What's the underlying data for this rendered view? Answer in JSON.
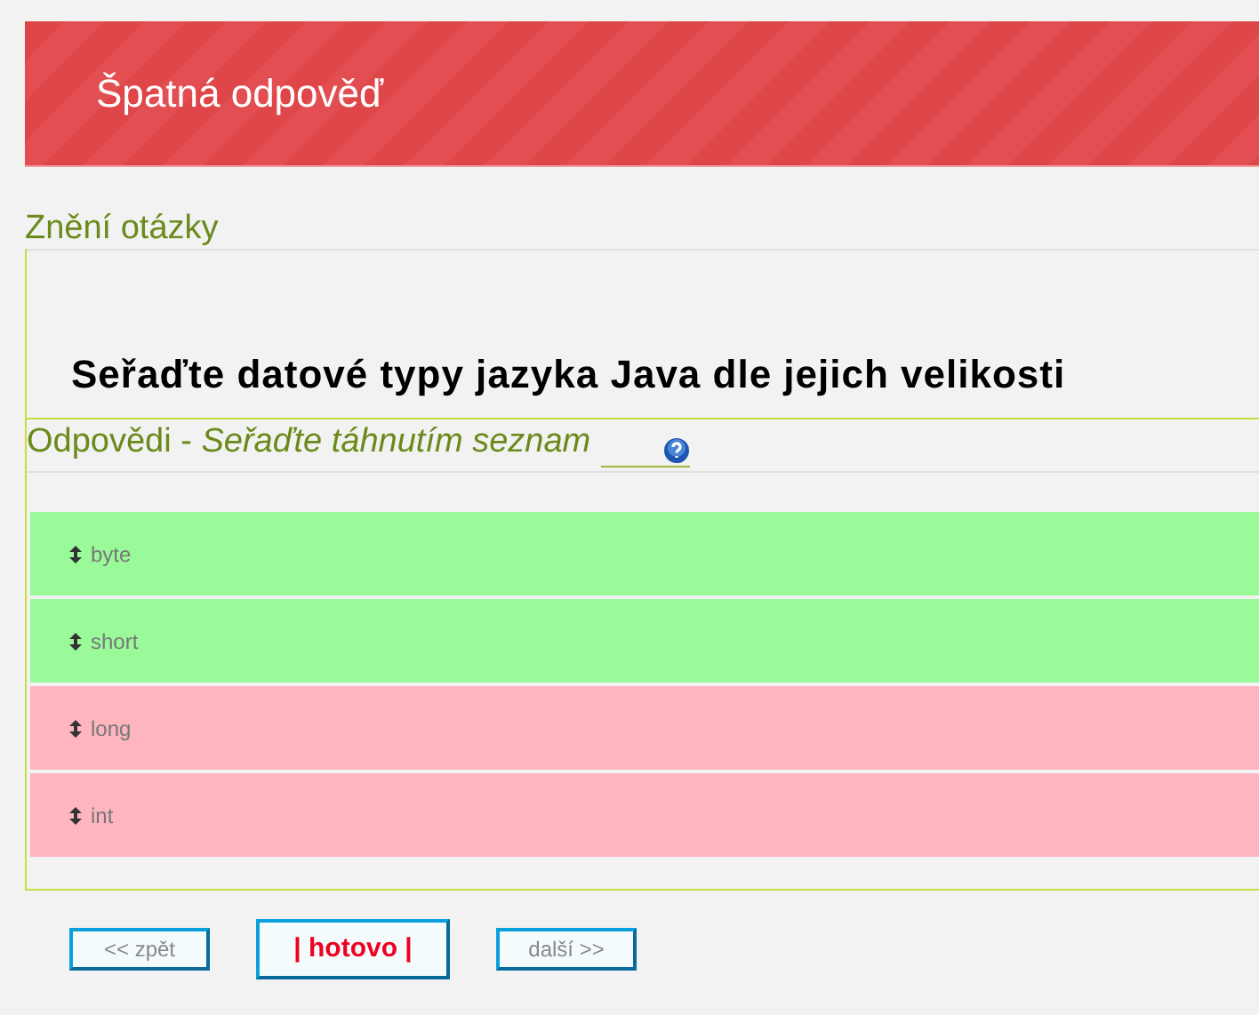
{
  "banner": {
    "title": "Špatná odpověď"
  },
  "question": {
    "heading": "Znění otázky",
    "text": "Seřaďte datové typy jazyka Java dle jejich velikosti"
  },
  "answers": {
    "heading": "Odpovědi - ",
    "instruction": "Seřaďte táhnutím seznam",
    "items": [
      {
        "label": "byte",
        "correct": true
      },
      {
        "label": "short",
        "correct": true
      },
      {
        "label": "long",
        "correct": false
      },
      {
        "label": "int",
        "correct": false
      }
    ]
  },
  "buttons": [
    {
      "label": "<< zpět",
      "kind": "nav"
    },
    {
      "label": "| hotovo |",
      "kind": "primary"
    },
    {
      "label": "další >>",
      "kind": "nav"
    }
  ]
}
